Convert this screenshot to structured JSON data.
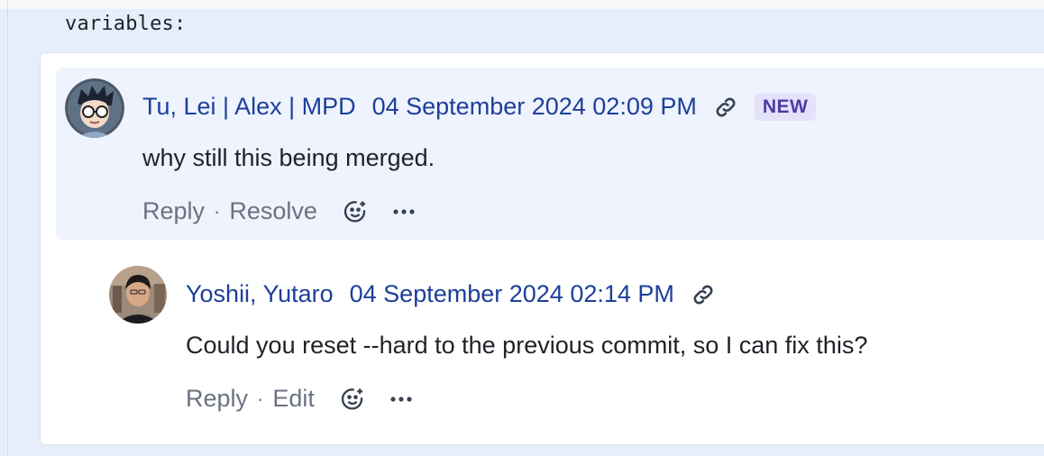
{
  "code": {
    "line": "variables:"
  },
  "comments": [
    {
      "author": "Tu, Lei | Alex | MPD",
      "timestamp": "04 September 2024 02:09 PM",
      "badge": "NEW",
      "body": "why still this being merged.",
      "actions": {
        "reply": "Reply",
        "secondary": "Resolve"
      }
    },
    {
      "author": "Yoshii, Yutaro",
      "timestamp": "04 September 2024 02:14 PM",
      "body": "Could you reset --hard to the previous commit, so I can fix this?",
      "actions": {
        "reply": "Reply",
        "secondary": "Edit"
      }
    }
  ],
  "separator": "·",
  "icons": {
    "link": "link-icon",
    "emoji": "add-reaction-icon",
    "more": "more-actions-icon"
  },
  "colors": {
    "link_text": "#1d3f9a",
    "new_badge_bg": "#e4e1fb",
    "new_badge_text": "#4c3aa6",
    "highlight_bg": "#eef3fd"
  }
}
